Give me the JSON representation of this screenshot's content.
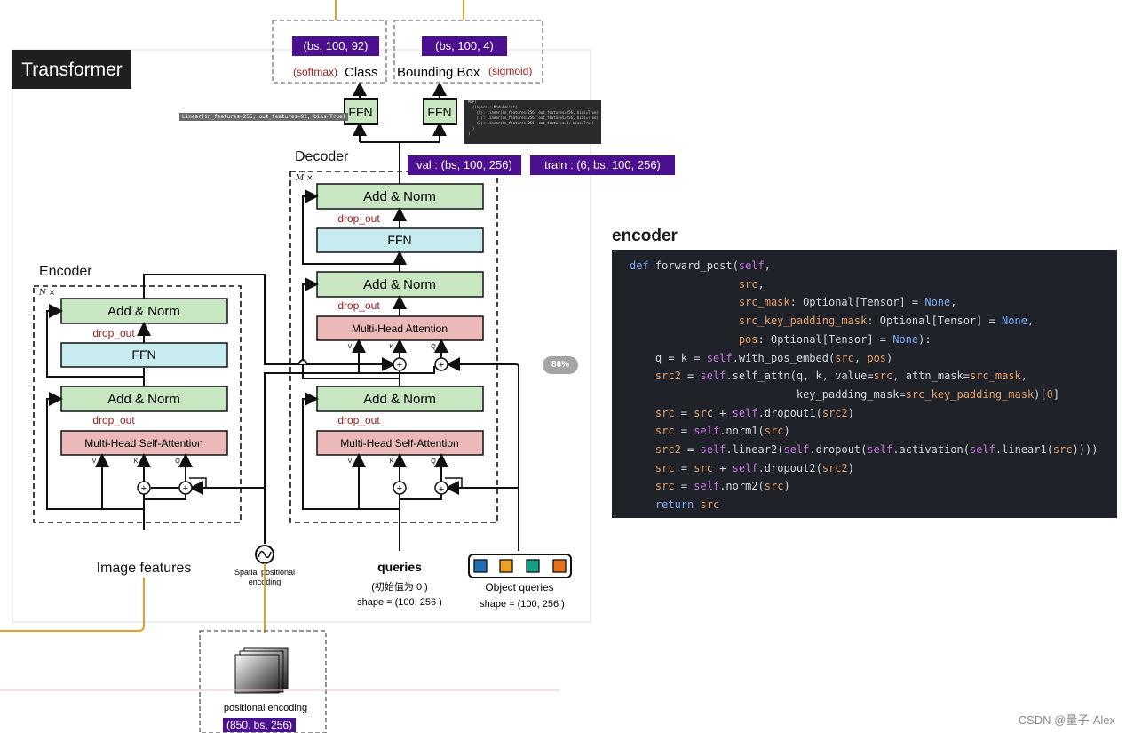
{
  "transformer": {
    "title": "Transformer",
    "encoder_label": "Encoder",
    "decoder_label": "Decoder",
    "n_times": "N ×",
    "m_times": "M ×",
    "add_norm": "Add & Norm",
    "ffn": "FFN",
    "multi_head_self_attention": "Multi-Head Self-Attention",
    "multi_head_attention": "Multi-Head Attention",
    "drop_out": "drop_out",
    "v": "V",
    "k": "K",
    "q": "Q",
    "image_features": "Image features",
    "spatial_positional_encoding_1": "Spatial positional",
    "spatial_positional_encoding_2": "encoding",
    "queries": "queries",
    "queries_init": "(初始值为 0 )",
    "queries_shape": "shape = (100, 256 )",
    "object_queries": "Object queries",
    "object_queries_shape": "shape = (100, 256 )",
    "ffn_head": "FFN",
    "class_tag": "(bs, 100, 92)",
    "bbox_tag": "(bs, 100, 4)",
    "softmax": "(softmax)",
    "class": "Class",
    "bounding_box": "Bounding Box",
    "sigmoid": "(sigmoid)",
    "val_tag": "val : (bs, 100, 256)",
    "train_tag": "train : (6, bs, 100, 256)",
    "linear_tooltip": "Linear(in_features=256, out_features=92, bias=True)",
    "mlp_lines": [
      "MLP(",
      "  (layers): ModuleList(",
      "    (0): Linear(in_features=256, out_features=256, bias=True)",
      "    (1): Linear(in_features=256, out_features=256, bias=True)",
      "    (2): Linear(in_features=256, out_features=4, bias=True)",
      "  )",
      ")"
    ],
    "positional_encoding": "positional encoding",
    "pos_tag": "(850, bs, 256)",
    "query_colors": [
      "#1f6fb5",
      "#f0a020",
      "#14a085",
      "#e8701a"
    ]
  },
  "zoom_badge": "86%",
  "encoder_code": {
    "title": "encoder",
    "lines": [
      "def forward_post(self,",
      "                 src,",
      "                 src_mask: Optional[Tensor] = None,",
      "                 src_key_padding_mask: Optional[Tensor] = None,",
      "                 pos: Optional[Tensor] = None):",
      "    q = k = self.with_pos_embed(src, pos)",
      "    src2 = self.self_attn(q, k, value=src, attn_mask=src_mask,",
      "                          key_padding_mask=src_key_padding_mask)[0]",
      "    src = src + self.dropout1(src2)",
      "    src = self.norm1(src)",
      "    src2 = self.linear2(self.dropout(self.activation(self.linear1(src))))",
      "    src = src + self.dropout2(src2)",
      "    src = self.norm2(src)",
      "    return src"
    ]
  },
  "watermark": "CSDN @量子-Alex",
  "colors": {
    "tag_bg": "#4b0f8f",
    "add_norm": "#c9e6c3",
    "ffn": "#c7ebee",
    "attention": "#eab9b8",
    "orange_line": "#e0a030",
    "code_bg": "#1f2229"
  }
}
